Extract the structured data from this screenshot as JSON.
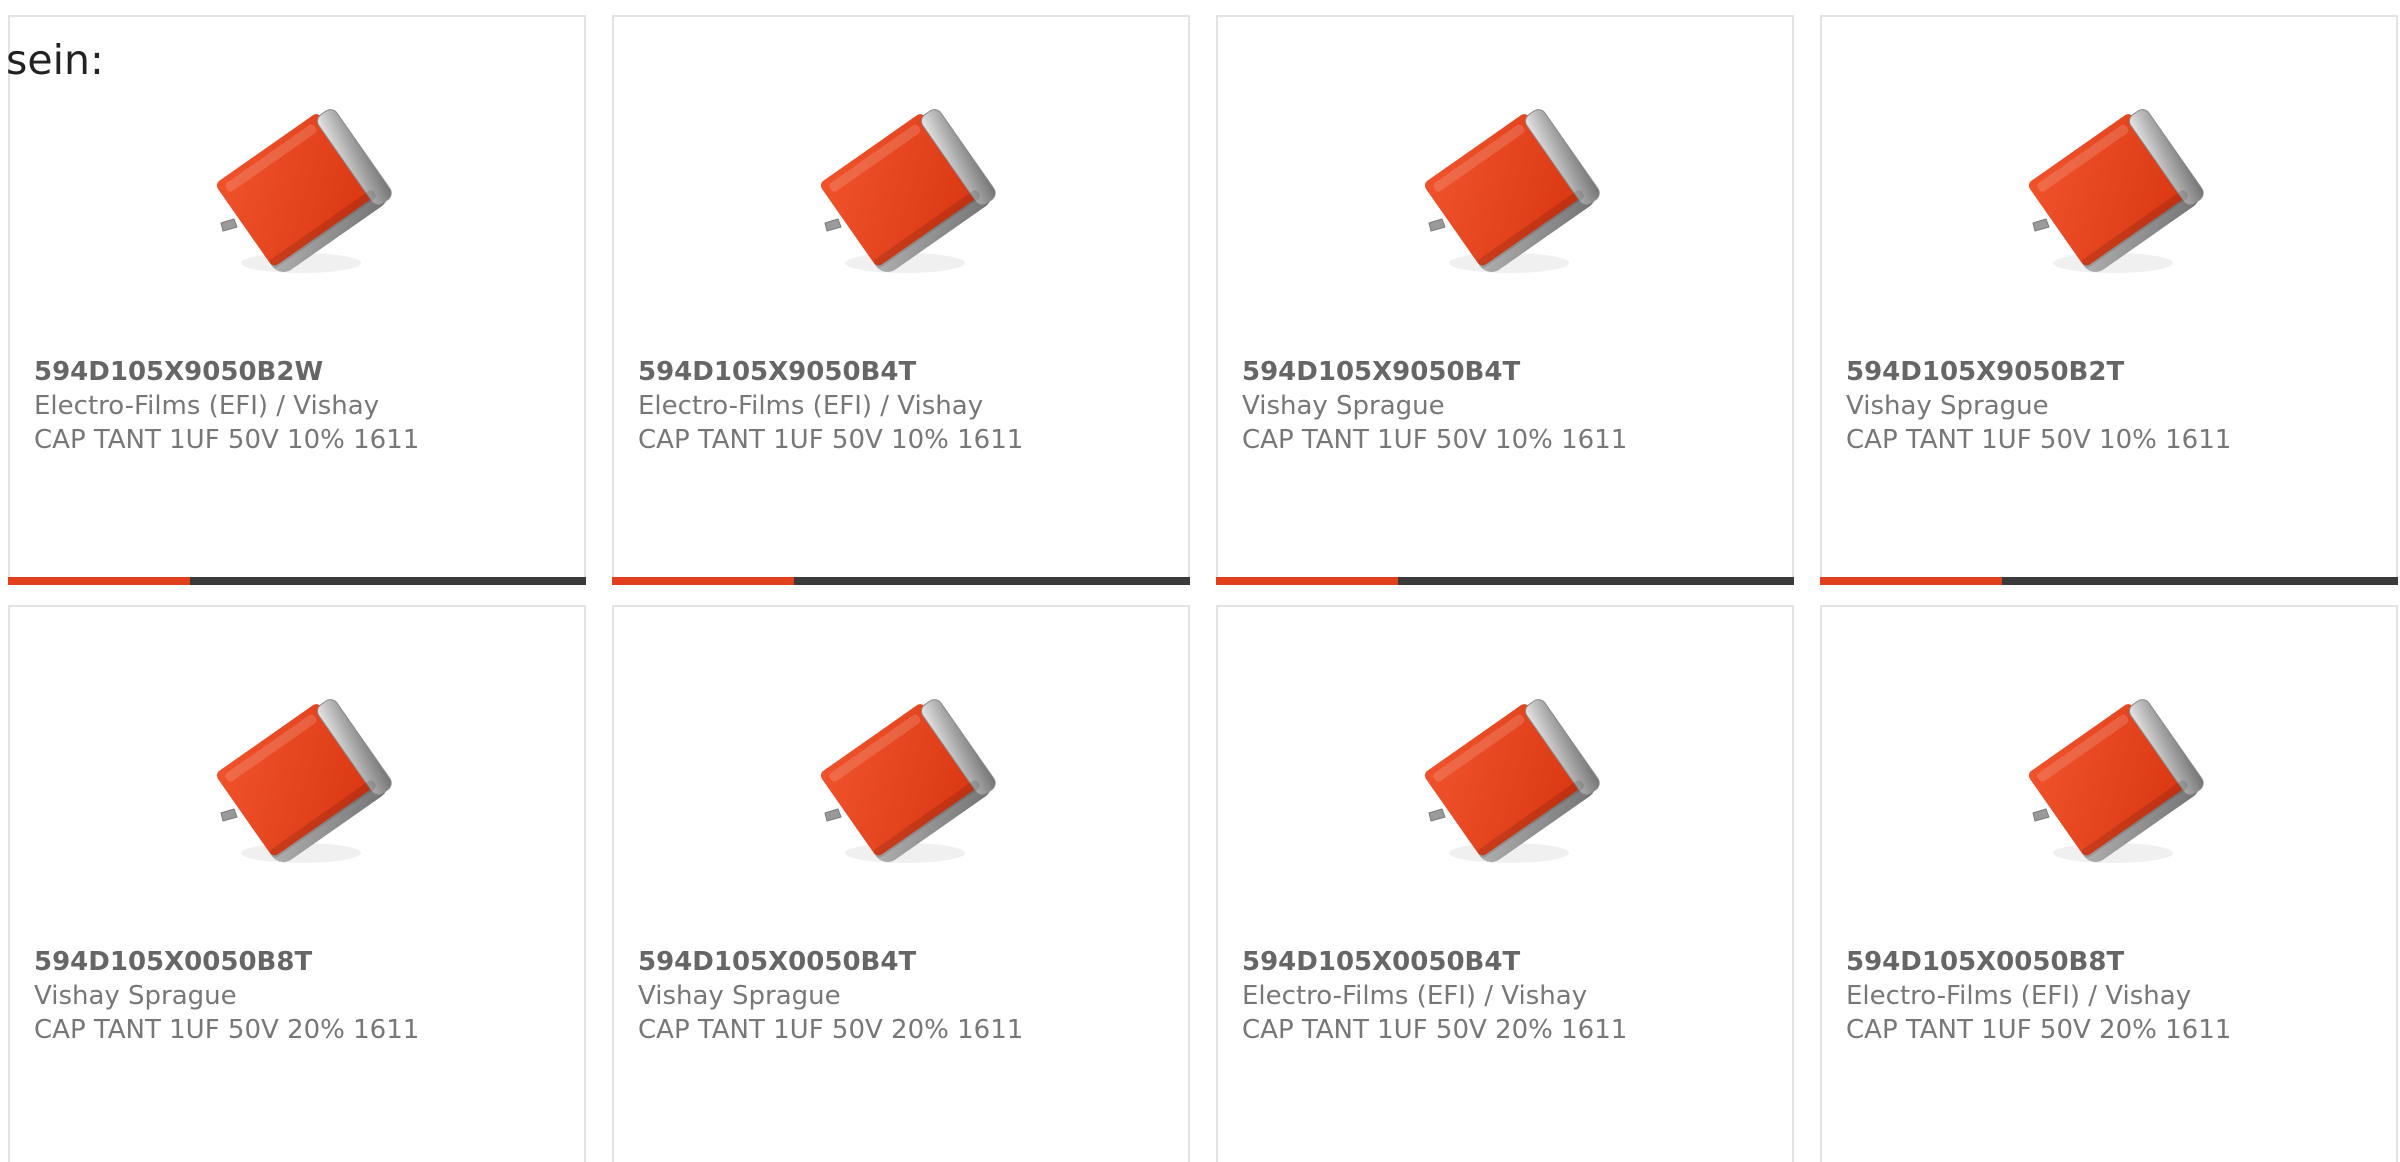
{
  "intro_text": "sein:",
  "colors": {
    "accent": "#e2401c",
    "bar_base": "#3a3a3a",
    "card_border": "#e3e3e3",
    "title_text": "#666666",
    "body_text": "#777777"
  },
  "products": [
    {
      "part_number": "594D105X9050B2W",
      "manufacturer": "Electro-Films (EFI) / Vishay",
      "description": "CAP TANT 1UF 50V 10% 1611",
      "image_icon": "tantalum-capacitor-image",
      "accent_fraction": 0.315
    },
    {
      "part_number": "594D105X9050B4T",
      "manufacturer": "Electro-Films (EFI) / Vishay",
      "description": "CAP TANT 1UF 50V 10% 1611",
      "image_icon": "tantalum-capacitor-image",
      "accent_fraction": 0.315
    },
    {
      "part_number": "594D105X9050B4T",
      "manufacturer": "Vishay Sprague",
      "description": "CAP TANT 1UF 50V 10% 1611",
      "image_icon": "tantalum-capacitor-image",
      "accent_fraction": 0.315
    },
    {
      "part_number": "594D105X9050B2T",
      "manufacturer": "Vishay Sprague",
      "description": "CAP TANT 1UF 50V 10% 1611",
      "image_icon": "tantalum-capacitor-image",
      "accent_fraction": 0.315
    },
    {
      "part_number": "594D105X0050B8T",
      "manufacturer": "Vishay Sprague",
      "description": "CAP TANT 1UF 50V 20% 1611",
      "image_icon": "tantalum-capacitor-image"
    },
    {
      "part_number": "594D105X0050B4T",
      "manufacturer": "Vishay Sprague",
      "description": "CAP TANT 1UF 50V 20% 1611",
      "image_icon": "tantalum-capacitor-image"
    },
    {
      "part_number": "594D105X0050B4T",
      "manufacturer": "Electro-Films (EFI) / Vishay",
      "description": "CAP TANT 1UF 50V 20% 1611",
      "image_icon": "tantalum-capacitor-image"
    },
    {
      "part_number": "594D105X0050B8T",
      "manufacturer": "Electro-Films (EFI) / Vishay",
      "description": "CAP TANT 1UF 50V 20% 1611",
      "image_icon": "tantalum-capacitor-image"
    }
  ]
}
